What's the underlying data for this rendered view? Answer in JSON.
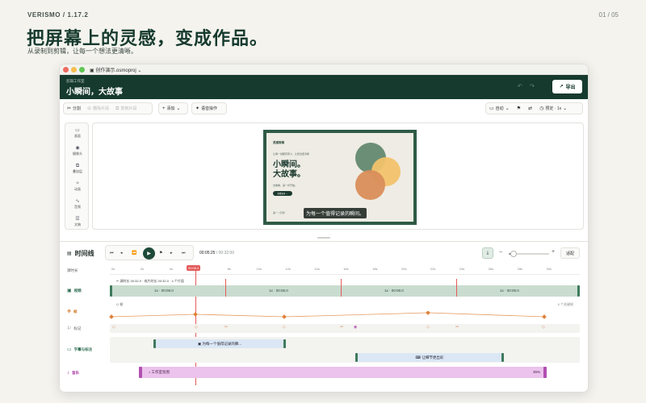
{
  "page": {
    "brand": "VERISMO  /  1.17.2",
    "pager": "01 / 05",
    "headline": "把屏幕上的灵感，变成作品。",
    "subhead": "从录制到剪辑，让每一个想法更清晰。"
  },
  "window": {
    "doc_title": "创作演示.osmoproj ⌄",
    "hero_small": "剪辑工作室",
    "hero_title": "小瞬间，大故事",
    "export_label": "导出"
  },
  "toolbar": {
    "split": "分割",
    "disabled_1": "删除片段",
    "disabled_2": "复制片段",
    "add": "添加",
    "voice": "语音操作",
    "auto": "自动",
    "preset": "预定 · 1x"
  },
  "sidebar": {
    "items": [
      "画面",
      "摄像头",
      "叠加层",
      "动画",
      "音频",
      "文稿"
    ]
  },
  "preview": {
    "slide_brand": "灵感剪辑",
    "slide_tag": "让每一帧都有意义，让想法更清晰",
    "slide_title_1": "小瞬间。",
    "slide_title_2": "大故事。",
    "slide_sub": "去看看，第一步开始。",
    "slide_button": "查看更多 →",
    "slide_footer": "第一 / 示例",
    "caption": "为每一个值得记录的瞬间。",
    "colors": {
      "green_circle": "#6b8f76",
      "yellow_circle": "#f2c36b",
      "orange_circle": "#d98e5a"
    }
  },
  "timeline": {
    "title": "时间线",
    "timecode_current": "00:05:25",
    "timecode_total": "/ 00:32:00",
    "fit_label": "适配",
    "zoom": 0.12,
    "ruler_ticks": [
      "0s",
      "2s",
      "4s",
      "6s",
      "8s",
      "10s",
      "12s",
      "14s",
      "16s",
      "18s",
      "20s",
      "22s",
      "24s",
      "26s",
      "28s",
      "30s"
    ],
    "playhead_label": "00:06.0",
    "labels": {
      "source": "源时长",
      "video": "视频",
      "keyframes": "帧",
      "markers": "标记",
      "subtitles": "字幕与标注",
      "music": "音乐"
    },
    "video_info": "源时长 00:32.0 · 成片时长 00:32.0 · 4 个片段",
    "video_segments": [
      "1x · 00:08.0",
      "1x · 00:08.0",
      "1x · 00:08.0",
      "1x · 00:08.0"
    ],
    "keyframe_title": "帧",
    "keyframe_count": "5 个关键帧",
    "subtitle_1": "为每一个值得记录的瞬...",
    "subtitle_2": "让细节更出彩",
    "music_name": "工作室氛围",
    "music_volume": "35%",
    "accent": "#e45a5a"
  }
}
